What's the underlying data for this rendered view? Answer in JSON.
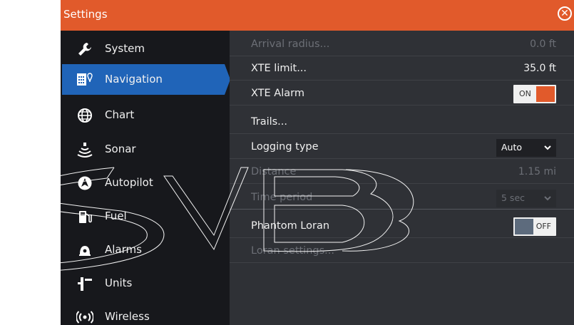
{
  "titlebar": {
    "title": "Settings",
    "close_symbol": "✕"
  },
  "colors": {
    "accent": "#e15a2b",
    "selected": "#2064b8",
    "sidebar_bg": "#17181c",
    "content_bg": "#2f3136",
    "disabled_text": "#6c6f76"
  },
  "sidebar": {
    "items": [
      {
        "label": "System",
        "icon": "wrench-icon"
      },
      {
        "label": "Navigation",
        "icon": "navigation-icon",
        "selected": true
      },
      {
        "label": "Chart",
        "icon": "globe-icon"
      },
      {
        "label": "Sonar",
        "icon": "sonar-icon"
      },
      {
        "label": "Autopilot",
        "icon": "autopilot-icon"
      },
      {
        "label": "Fuel",
        "icon": "fuel-pump-icon"
      },
      {
        "label": "Alarms",
        "icon": "alarm-bell-icon"
      },
      {
        "label": "Units",
        "icon": "units-icon"
      },
      {
        "label": "Wireless",
        "icon": "wireless-icon"
      }
    ]
  },
  "settings": {
    "arrival_radius": {
      "label": "Arrival radius...",
      "value": "0.0 ft"
    },
    "xte_limit": {
      "label": "XTE limit...",
      "value": "35.0 ft"
    },
    "xte_alarm": {
      "label": "XTE Alarm",
      "state": "ON"
    },
    "trails": {
      "label": "Trails..."
    },
    "logging_type": {
      "label": "Logging type",
      "value": "Auto"
    },
    "distance": {
      "label": "Distance",
      "value": "1.15 mi"
    },
    "time_period": {
      "label": "Time period",
      "value": "5 sec"
    },
    "phantom_loran": {
      "label": "Phantom Loran",
      "state": "OFF"
    },
    "loran_settings": {
      "label": "Loran settings..."
    }
  }
}
